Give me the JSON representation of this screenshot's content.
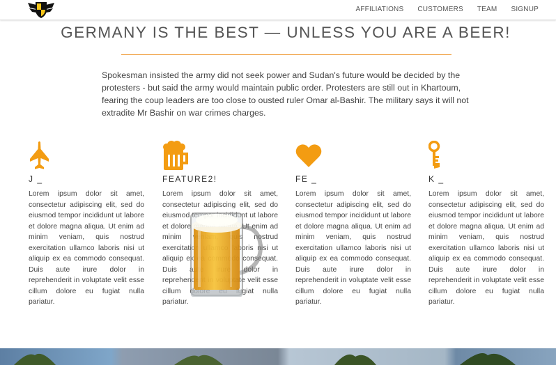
{
  "nav": {
    "logo_icon": "winged-badge-logo-icon",
    "links": [
      "AFFILIATIONS",
      "CUSTOMERS",
      "TEAM",
      "SIGNUP"
    ]
  },
  "hero": {
    "title": "GERMANY IS THE BEST — UNLESS YOU ARE A BEER!",
    "intro": "Spokesman insisted the army did not seek power and Sudan's future would be decided by the protesters - but said the army would maintain public order. Protesters are still out in Khartoum, fearing the coup leaders are too close to ousted ruler Omar al-Bashir. The military says it will not extradite Mr Bashir on war crimes charges."
  },
  "colors": {
    "accent": "#f39c12",
    "rule": "#f0a040"
  },
  "features": [
    {
      "icon": "fighter-jet-icon",
      "title": "J _",
      "text": "Lorem ipsum dolor sit amet, consectetur adipiscing elit, sed do eiusmod tempor incididunt ut labore et dolore magna aliqua. Ut enim ad minim veniam, quis nostrud exercitation ullamco laboris nisi ut aliquip ex ea commodo consequat. Duis aute irure dolor in reprehenderit in voluptate velit esse cillum dolore eu fugiat nulla pariatur."
    },
    {
      "icon": "beer-mug-icon",
      "title": "FEATURE2!",
      "text": "Lorem ipsum dolor sit amet, consectetur adipiscing elit, sed do eiusmod tempor incididunt ut labore et dolore magna aliqua. Ut enim ad minim veniam, quis nostrud exercitation ullamco laboris nisi ut aliquip ex ea commodo consequat. Duis aute irure dolor in reprehenderit in voluptate velit esse cillum dolore eu fugiat nulla pariatur."
    },
    {
      "icon": "heart-icon",
      "title": "FE _",
      "text": "Lorem ipsum dolor sit amet, consectetur adipiscing elit, sed do eiusmod tempor incididunt ut labore et dolore magna aliqua. Ut enim ad minim veniam, quis nostrud exercitation ullamco laboris nisi ut aliquip ex ea commodo consequat. Duis aute irure dolor in reprehenderit in voluptate velit esse cillum dolore eu fugiat nulla pariatur."
    },
    {
      "icon": "key-icon",
      "title": "K _",
      "text": "Lorem ipsum dolor sit amet, consectetur adipiscing elit, sed do eiusmod tempor incididunt ut labore et dolore magna aliqua. Ut enim ad minim veniam, quis nostrud exercitation ullamco laboris nisi ut aliquip ex ea commodo consequat. Duis aute irure dolor in reprehenderit in voluptate velit esse cillum dolore eu fugiat nulla pariatur."
    }
  ],
  "overlay_image": "beer-mug-image",
  "footer_image": "palm-trees-photo-strip"
}
